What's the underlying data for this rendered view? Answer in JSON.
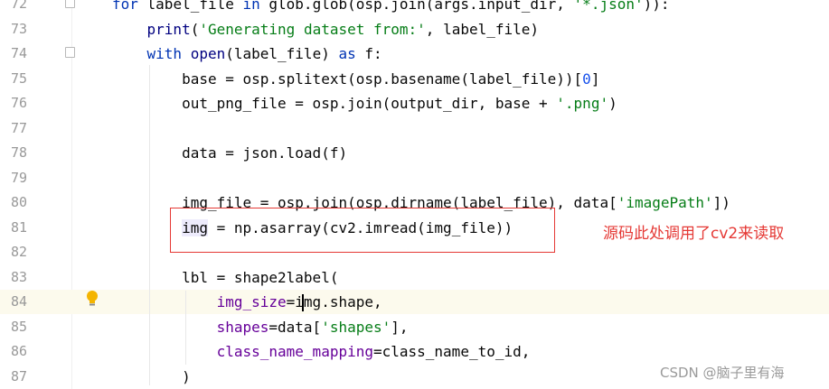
{
  "editor": {
    "lines": [
      {
        "num": "72",
        "segments": [
          {
            "t": "for",
            "c": "kw"
          },
          {
            "t": " label_file "
          },
          {
            "t": "in",
            "c": "kw"
          },
          {
            "t": " glob.glob(osp.join(args.input_dir, "
          },
          {
            "t": "'*.json'",
            "c": "str"
          },
          {
            "t": ")):"
          }
        ]
      },
      {
        "num": "73",
        "segments": [
          {
            "t": "    "
          },
          {
            "t": "print",
            "c": "bi"
          },
          {
            "t": "("
          },
          {
            "t": "'Generating dataset from:'",
            "c": "str"
          },
          {
            "t": ", label_file)"
          }
        ]
      },
      {
        "num": "74",
        "segments": [
          {
            "t": "    "
          },
          {
            "t": "with",
            "c": "kw"
          },
          {
            "t": " "
          },
          {
            "t": "open",
            "c": "bi"
          },
          {
            "t": "(label_file) "
          },
          {
            "t": "as",
            "c": "kw"
          },
          {
            "t": " f:"
          }
        ]
      },
      {
        "num": "75",
        "segments": [
          {
            "t": "        base = osp.splitext(osp.basename(label_file))["
          },
          {
            "t": "0",
            "c": "num"
          },
          {
            "t": "]"
          }
        ]
      },
      {
        "num": "76",
        "segments": [
          {
            "t": "        out_png_file = osp.join(output_dir, base + "
          },
          {
            "t": "'.png'",
            "c": "str"
          },
          {
            "t": ")"
          }
        ]
      },
      {
        "num": "77",
        "segments": []
      },
      {
        "num": "78",
        "segments": [
          {
            "t": "        data = json.load(f)"
          }
        ]
      },
      {
        "num": "79",
        "segments": []
      },
      {
        "num": "80",
        "segments": [
          {
            "t": "        img_file = osp.join(osp.dirname(label_file), data["
          },
          {
            "t": "'imagePath'",
            "c": "str"
          },
          {
            "t": "])"
          }
        ]
      },
      {
        "num": "81",
        "segments": [
          {
            "t": "        "
          },
          {
            "t": "img",
            "c": "hl"
          },
          {
            "t": " = np.asarray(cv2.imread(img_file))"
          }
        ]
      },
      {
        "num": "82",
        "segments": []
      },
      {
        "num": "83",
        "segments": [
          {
            "t": "        lbl = shape2label("
          }
        ]
      },
      {
        "num": "84",
        "segments": [
          {
            "t": "            "
          },
          {
            "t": "img_size",
            "c": "par"
          },
          {
            "t": "=img.shape,"
          }
        ]
      },
      {
        "num": "85",
        "segments": [
          {
            "t": "            "
          },
          {
            "t": "shapes",
            "c": "par"
          },
          {
            "t": "=data["
          },
          {
            "t": "'shapes'",
            "c": "str"
          },
          {
            "t": "],"
          }
        ]
      },
      {
        "num": "86",
        "segments": [
          {
            "t": "            "
          },
          {
            "t": "class_name_mapping",
            "c": "par"
          },
          {
            "t": "=class_name_to_id,"
          }
        ]
      },
      {
        "num": "87",
        "segments": [
          {
            "t": "        )"
          }
        ]
      }
    ],
    "current_line": "84"
  },
  "annotation": {
    "note": "源码此处调用了cv2来读取"
  },
  "watermark": "CSDN @脑子里有海",
  "icons": {
    "bulb": "lightbulb-icon",
    "fold": "fold-marker-icon"
  },
  "colors": {
    "keyword": "#0033b3",
    "string": "#067d17",
    "number": "#1750eb",
    "param": "#660099",
    "annotation": "#e53935"
  }
}
